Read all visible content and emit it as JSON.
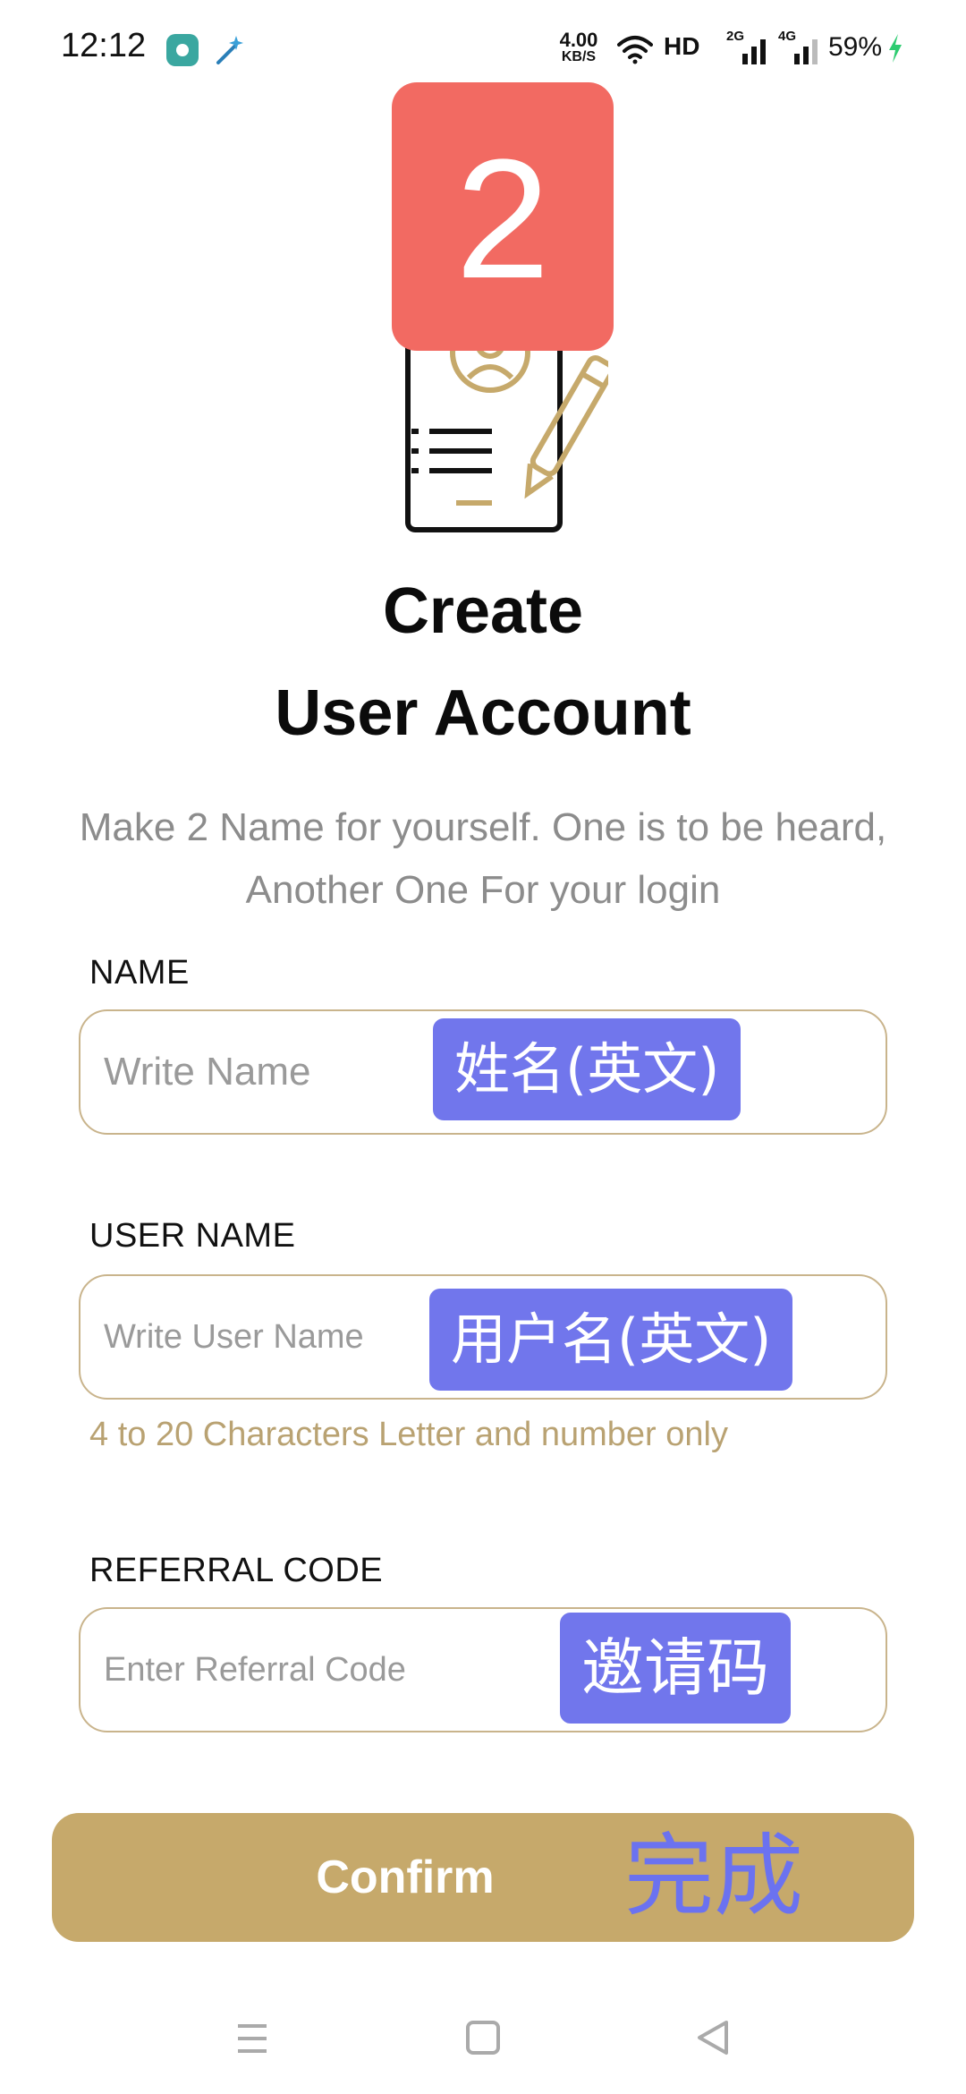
{
  "status_bar": {
    "time": "12:12",
    "net_speed_value": "4.00",
    "net_speed_unit": "KB/S",
    "hd_label": "HD",
    "signal1_label": "2G",
    "signal2_label": "4G",
    "battery": "59%",
    "icons": [
      "app-icon",
      "magic-wand-icon",
      "wifi-icon",
      "signal-icon",
      "signal-icon",
      "charging-icon"
    ]
  },
  "header": {
    "step_badge": "2",
    "title_line1": "Create",
    "title_line2": "User Account",
    "subtitle": "Make 2 Name for yourself. One is to be heard, Another One For your login"
  },
  "form": {
    "name": {
      "label": "NAME",
      "placeholder": "Write Name",
      "value": "",
      "annotation": "姓名(英文)"
    },
    "username": {
      "label": "USER NAME",
      "placeholder": "Write User Name",
      "value": "",
      "annotation": "用户名(英文)",
      "helper": "4 to 20 Characters Letter and number only"
    },
    "referral": {
      "label": "REFERRAL CODE",
      "placeholder": "Enter Referral Code",
      "value": "",
      "annotation": "邀请码"
    }
  },
  "confirm": {
    "label": "Confirm",
    "annotation": "完成"
  },
  "colors": {
    "accent_gold": "#c6a96b",
    "field_border": "#c9b48c",
    "helper_text": "#b9a272",
    "badge_red": "#f26a62",
    "annotation_purple": "#7176ec"
  },
  "nav_bar": {
    "icons": [
      "menu-icon",
      "home-icon",
      "back-icon"
    ]
  }
}
